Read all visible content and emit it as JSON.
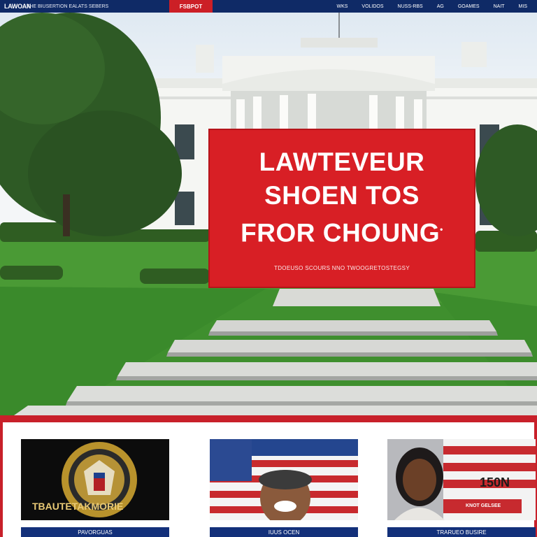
{
  "nav": {
    "brand": "LAWOAN",
    "tagline": "THE BIUSERTION EALATS SEBERS",
    "highlight": "FSBPOT",
    "links": [
      "WKS",
      "VOLIDOS",
      "NUSS-RBS",
      "AG",
      "GOAMES",
      "NAIT",
      "MIS"
    ]
  },
  "hero": {
    "banner": {
      "line1": "LAWTEVEUR",
      "line2": "SHOEN TOS",
      "line3": "FROR CHOUNG",
      "mark": "•",
      "subtext": "TDOEUSO SCOURS NNO TWOOGRETOSTEGSY"
    }
  },
  "cards": [
    {
      "overlay": "TBAUTETAKMORIE",
      "caption": "PAVORGUAS"
    },
    {
      "overlay": "",
      "caption": "IUUS OCEN"
    },
    {
      "overlay": "150N",
      "overlay_sub": "KNOT GELSEE",
      "caption": "TRARUEO BUSIRE"
    }
  ],
  "colors": {
    "nav_bg": "#0f2a66",
    "accent_red": "#d81f25",
    "caption_bg": "#13307a"
  }
}
